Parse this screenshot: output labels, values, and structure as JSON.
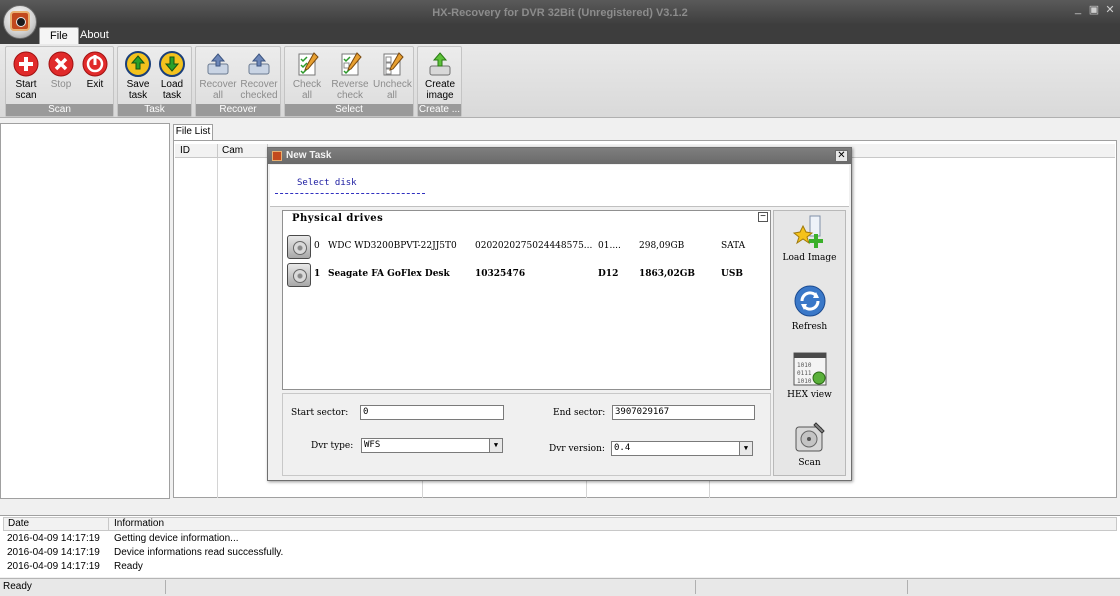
{
  "window": {
    "title": "HX-Recovery for DVR 32Bit (Unregistered) V3.1.2"
  },
  "menu": {
    "file": "File",
    "about": "About"
  },
  "ribbon": {
    "scan": {
      "label": "Scan",
      "start": "Start scan",
      "start1": "Start",
      "start2": "scan",
      "stop": "Stop",
      "exit": "Exit"
    },
    "task": {
      "label": "Task",
      "save1": "Save",
      "save2": "task",
      "load1": "Load",
      "load2": "task"
    },
    "recover": {
      "label": "Recover",
      "all1": "Recover",
      "all2": "all",
      "checked1": "Recover",
      "checked2": "checked"
    },
    "select": {
      "label": "Select",
      "checkall": "Check all",
      "rev1": "Reverse",
      "rev2": "check",
      "un1": "Uncheck",
      "un2": "all"
    },
    "create": {
      "label": "Create ...",
      "img1": "Create",
      "img2": "image"
    }
  },
  "filelist": {
    "tab": "File List",
    "columns": [
      "ID",
      "Cam"
    ]
  },
  "dialog": {
    "title": "New Task",
    "subtitle": "Select disk",
    "drives_title": "Physical drives",
    "drives": [
      {
        "index": "0",
        "model": "WDC WD3200BPVT-22JJ5T0",
        "serial": "0202020275024448575...",
        "fw": "01....",
        "size": "298,09GB",
        "bus": "SATA"
      },
      {
        "index": "1",
        "model": "Seagate FA GoFlex Desk",
        "serial": "10325476",
        "fw": "D12",
        "size": "1863,02GB",
        "bus": "USB"
      }
    ],
    "tools": {
      "load_image": "Load Image",
      "refresh": "Refresh",
      "hex_view": "HEX view",
      "scan": "Scan"
    },
    "params": {
      "start_sector_label": "Start sector:",
      "start_sector": "0",
      "end_sector_label": "End sector:",
      "end_sector": "3907029167",
      "dvr_type_label": "Dvr type:",
      "dvr_type": "WFS",
      "dvr_version_label": "Dvr version:",
      "dvr_version": "0.4"
    }
  },
  "log": {
    "headers": [
      "Date",
      "Information"
    ],
    "rows": [
      {
        "date": "2016-04-09 14:17:19",
        "info": "Getting device information..."
      },
      {
        "date": "2016-04-09 14:17:19",
        "info": "Device informations read successfully."
      },
      {
        "date": "2016-04-09 14:17:19",
        "info": "Ready"
      }
    ]
  },
  "status": {
    "text": "Ready"
  }
}
